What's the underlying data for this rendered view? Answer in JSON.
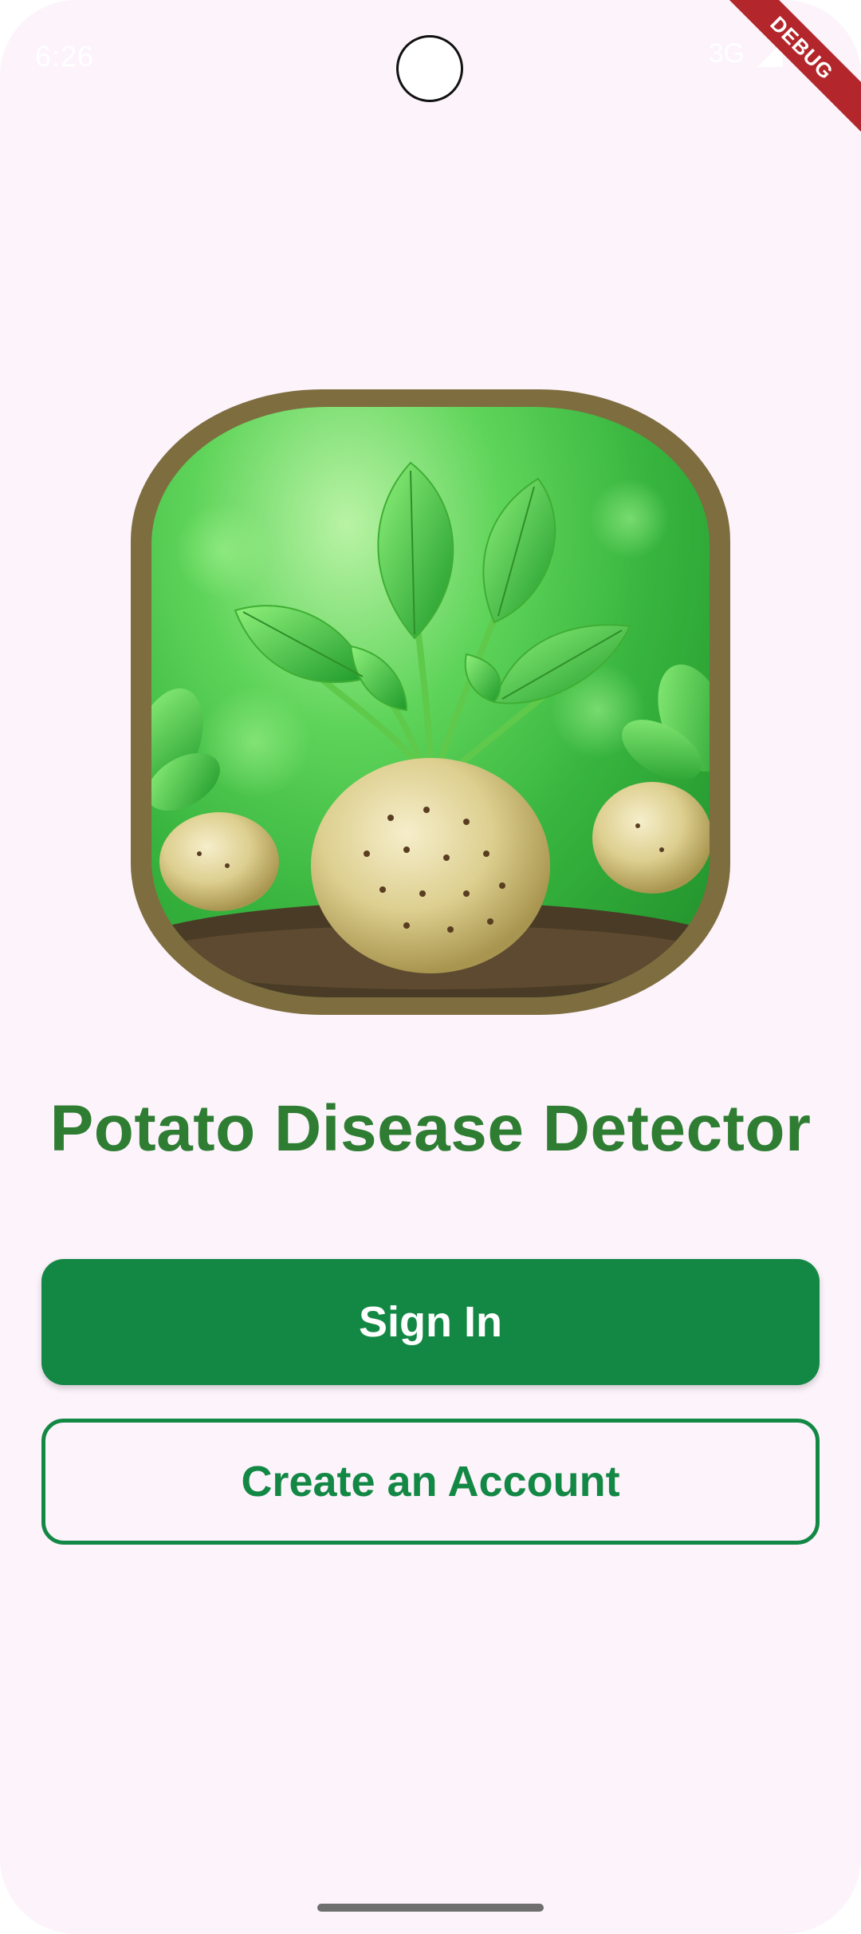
{
  "status_bar": {
    "time": "6:26",
    "network": "3G"
  },
  "debug_banner": "DEBUG",
  "hero": {
    "icon": "potato-plant-illustration"
  },
  "title": "Potato Disease Detector",
  "buttons": {
    "sign_in": "Sign In",
    "create_account": "Create an Account"
  },
  "colors": {
    "background": "#fcf3fb",
    "title": "#2e7d32",
    "primary": "#138845",
    "frame": "#7e6d3f",
    "debug": "#b3262b"
  }
}
